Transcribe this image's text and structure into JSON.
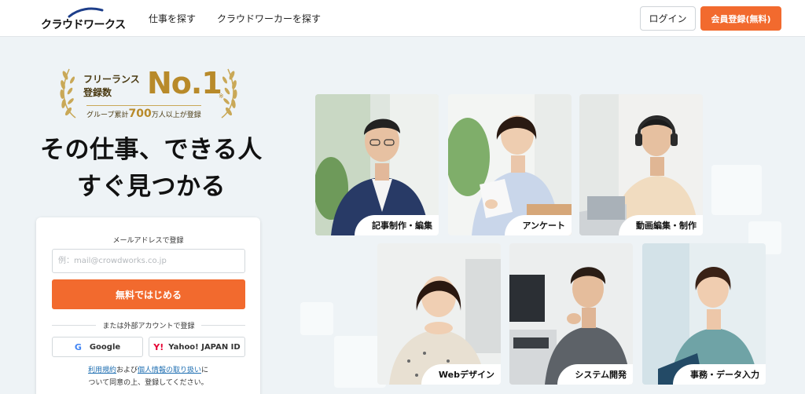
{
  "header": {
    "logo_text": "クラウドワークス",
    "nav": [
      {
        "label": "仕事を探す"
      },
      {
        "label": "クラウドワーカーを探す"
      }
    ],
    "login_label": "ログイン",
    "register_label": "会員登録(無料)"
  },
  "award": {
    "line1": "フリーランス",
    "line2": "登録数",
    "rank": "No.1",
    "note_mark": "※",
    "sub_prefix": "グループ累計",
    "sub_number": "700",
    "sub_suffix": "万人以上が登録"
  },
  "headline": {
    "line1": "その仕事、できる人",
    "line2": "すぐ見つかる"
  },
  "form": {
    "email_label": "メールアドレスで登録",
    "email_placeholder": "例：mail@crowdworks.co.jp",
    "email_value": "",
    "submit_label": "無料ではじめる",
    "external_label": "または外部アカウントで登録",
    "google_icon": "G",
    "google_label": "Google",
    "yahoo_icon": "Y!",
    "yahoo_label": "Yahoo! JAPAN ID",
    "terms_link": "利用規約",
    "terms_and": "および",
    "privacy_link": "個人情報の取り扱い",
    "terms_suffix": "に",
    "terms_line2": "ついて同意の上、登録してください。"
  },
  "categories": [
    {
      "label": "記事制作・編集",
      "icon": "writer-photo"
    },
    {
      "label": "アンケート",
      "icon": "survey-photo"
    },
    {
      "label": "動画編集・制作",
      "icon": "video-editor-photo"
    },
    {
      "label": "Webデザイン",
      "icon": "web-designer-photo"
    },
    {
      "label": "システム開発",
      "icon": "developer-photo"
    },
    {
      "label": "事務・データ入力",
      "icon": "data-entry-photo"
    }
  ],
  "colors": {
    "accent": "#f26a2e",
    "gold": "#b88a2a",
    "link": "#1f6fb2",
    "background": "#eef3f6"
  }
}
